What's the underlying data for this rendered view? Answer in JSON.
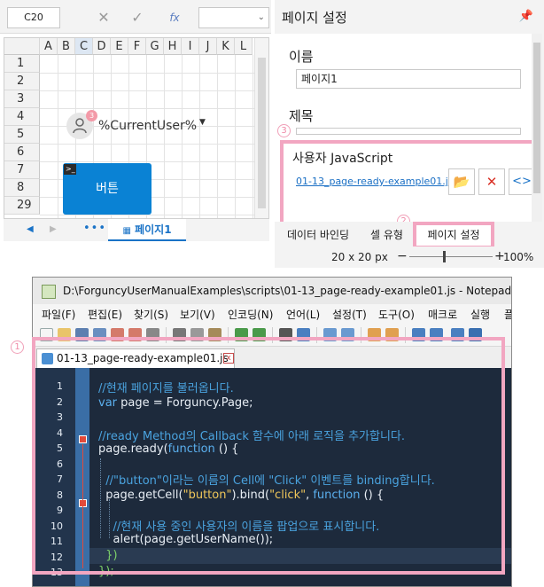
{
  "formula_bar": {
    "cell_ref": "C20",
    "fx_label": "fx"
  },
  "sheet": {
    "columns": [
      "A",
      "B",
      "C",
      "D",
      "E",
      "F",
      "G",
      "H",
      "I",
      "J",
      "K",
      "L"
    ],
    "selected_column": "C",
    "rows": [
      "1",
      "2",
      "3",
      "4",
      "5",
      "6",
      "7",
      "8",
      "29"
    ],
    "user_widget_text": "%CurrentUser%",
    "user_badge": "3",
    "button_text": "버튼",
    "button_icon": "terminal-icon",
    "more": "•••",
    "active_tab": "페이지1"
  },
  "right_panel": {
    "title": "페이지 설정",
    "name_label": "이름",
    "name_value": "페이지1",
    "title_label": "제목",
    "title_value": "",
    "js_label": "사용자 JavaScript",
    "js_file": "01-13_page-ready-example01.js",
    "marker_3": "3",
    "marker_2": "2",
    "tabs": [
      "데이터 바인딩",
      "셀 유형"
    ],
    "active_tab": "페이지 설정",
    "zoom_size": "20 x 20 px",
    "zoom_minus": "−",
    "zoom_plus": "+",
    "zoom_pct": "100%"
  },
  "notepad": {
    "title": "D:\\ForguncyUserManualExamples\\scripts\\01-13_page-ready-example01.js - Notepad++",
    "menu": [
      "파일(F)",
      "편집(E)",
      "찾기(S)",
      "보기(V)",
      "인코딩(N)",
      "언어(L)",
      "설정(T)",
      "도구(O)",
      "매크로",
      "실행",
      "플"
    ],
    "tab_label": "01-13_page-ready-example01.js",
    "close_glyph": "x",
    "marker_1": "1",
    "line_numbers": [
      "1",
      "2",
      "3",
      "4",
      "5",
      "6",
      "7",
      "8",
      "9",
      "10",
      "11",
      "12",
      "13"
    ],
    "code": {
      "l1": "//현재 페이지를 불러옵니다.",
      "l2_kw": "var",
      "l2_rest": " page = Forguncy.Page;",
      "l4": "//ready Method의 Callback 함수에 아래 로직을 추가합니다.",
      "l5_a": "page.ready(",
      "l5_kw": "function",
      "l5_b": " () {",
      "l7": "  //\"button\"이라는 이름의 Cell에 \"Click\" 이벤트를 binding합니다.",
      "l8_a": "  page.getCell(",
      "l8_s1": "\"button\"",
      "l8_b": ").bind(",
      "l8_s2": "\"click\"",
      "l8_c": ", ",
      "l8_kw": "function",
      "l8_d": " () {",
      "l10": "    //현재 사용 중인 사용자의 이름을 팝업으로 표시합니다.",
      "l11": "    alert(page.getUserName());",
      "l12": "  })",
      "l13": "});"
    }
  },
  "colors": {
    "highlight_pink": "#f2a6c1",
    "button_blue": "#0a82d4",
    "editor_bg": "#1d2a3c"
  }
}
